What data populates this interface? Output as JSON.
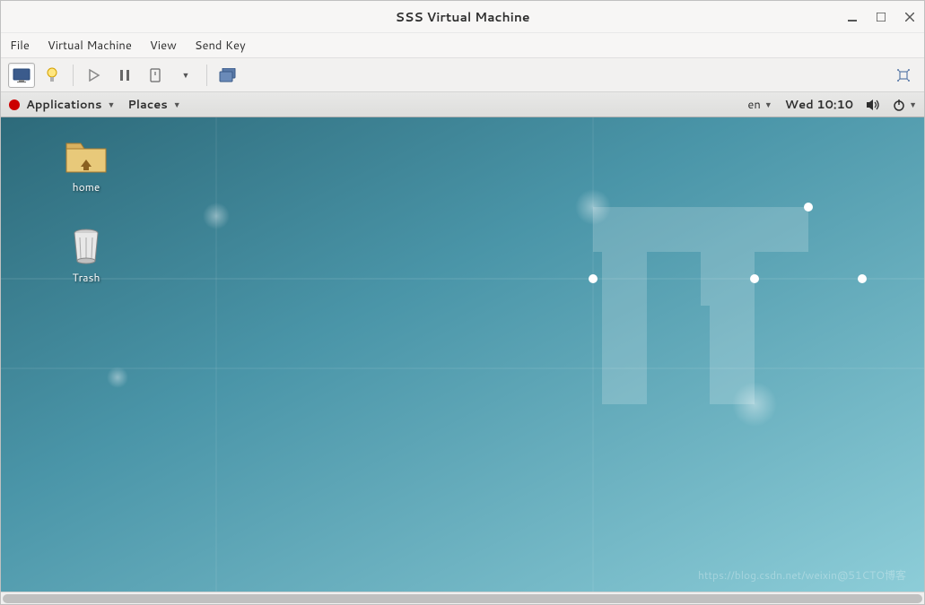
{
  "titlebar": {
    "title": "SSS Virtual Machine"
  },
  "menubar": {
    "file": "File",
    "vm": "Virtual Machine",
    "view": "View",
    "sendkey": "Send Key"
  },
  "guest_topbar": {
    "applications": "Applications",
    "places": "Places",
    "lang": "en",
    "clock": "Wed 10:10"
  },
  "desktop": {
    "home_label": "home",
    "trash_label": "Trash"
  },
  "watermark": "https://blog.csdn.net/weixin@51CTO博客"
}
